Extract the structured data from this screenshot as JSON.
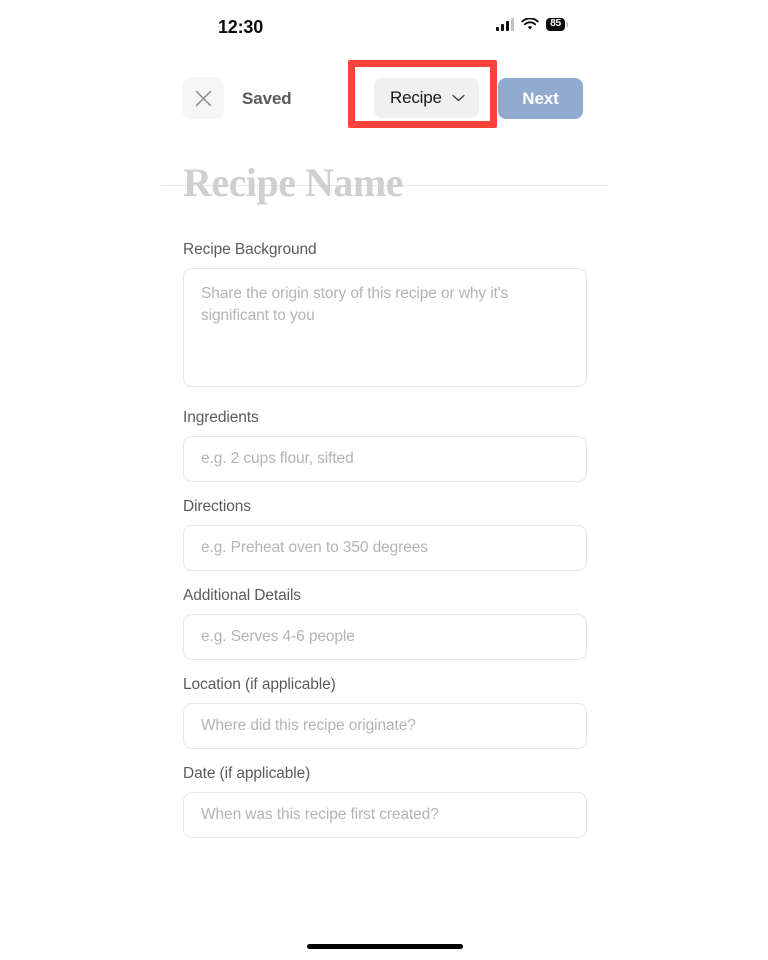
{
  "status_bar": {
    "time": "12:30",
    "signal_icon": "cellular-signal-icon",
    "wifi_icon": "wifi-icon",
    "battery_level": "85"
  },
  "header": {
    "close_icon": "close-icon",
    "saved_label": "Saved",
    "type_selector": {
      "value": "Recipe",
      "chevron_icon": "chevron-down-icon"
    },
    "next_label": "Next"
  },
  "annotation": {
    "target": "type-selector-dropdown",
    "color": "#f9423a"
  },
  "form": {
    "title_placeholder": "Recipe Name",
    "fields": [
      {
        "label": "Recipe Background",
        "placeholder": "Share the origin story of this recipe or why it's significant to you",
        "value": "",
        "type": "textarea"
      },
      {
        "label": "Ingredients",
        "placeholder": "e.g. 2 cups flour, sifted",
        "value": "",
        "type": "input"
      },
      {
        "label": "Directions",
        "placeholder": "e.g. Preheat oven to 350 degrees",
        "value": "",
        "type": "input"
      },
      {
        "label": "Additional Details",
        "placeholder": "e.g. Serves 4-6 people",
        "value": "",
        "type": "input"
      },
      {
        "label": "Location (if applicable)",
        "placeholder": "Where did this recipe originate?",
        "value": "",
        "type": "input"
      },
      {
        "label": "Date (if applicable)",
        "placeholder": "When was this recipe first created?",
        "value": "",
        "type": "input"
      }
    ]
  },
  "home_indicator": "home-indicator"
}
